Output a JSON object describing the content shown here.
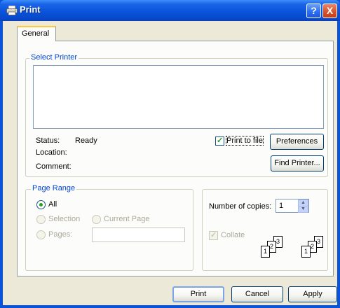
{
  "window": {
    "title": "Print",
    "help_button": "?",
    "close_button": "X"
  },
  "tabs": [
    {
      "label": "General",
      "selected": true
    }
  ],
  "select_printer": {
    "legend": "Select Printer",
    "printers": [],
    "status_label": "Status:",
    "status_value": "Ready",
    "location_label": "Location:",
    "location_value": "",
    "comment_label": "Comment:",
    "comment_value": "",
    "print_to_file": {
      "label": "Print to file",
      "checked": true
    },
    "preferences_button": "Preferences",
    "find_printer_button": "Find Printer..."
  },
  "page_range": {
    "legend": "Page Range",
    "options": {
      "all": "All",
      "selection": "Selection",
      "current_page": "Current Page",
      "pages": "Pages:"
    },
    "selected": "all",
    "pages_value": ""
  },
  "copies": {
    "label": "Number of copies:",
    "value": "1",
    "collate": {
      "label": "Collate",
      "checked": true,
      "enabled": false
    },
    "collate_pages": [
      "1",
      "2",
      "3"
    ]
  },
  "footer": {
    "print_button": "Print",
    "cancel_button": "Cancel",
    "apply_button": "Apply"
  },
  "colors": {
    "titlebar": "#0a54dc",
    "legend_text": "#0046d5",
    "dialog_bg": "#ece9d8",
    "check_green": "#21a121"
  }
}
